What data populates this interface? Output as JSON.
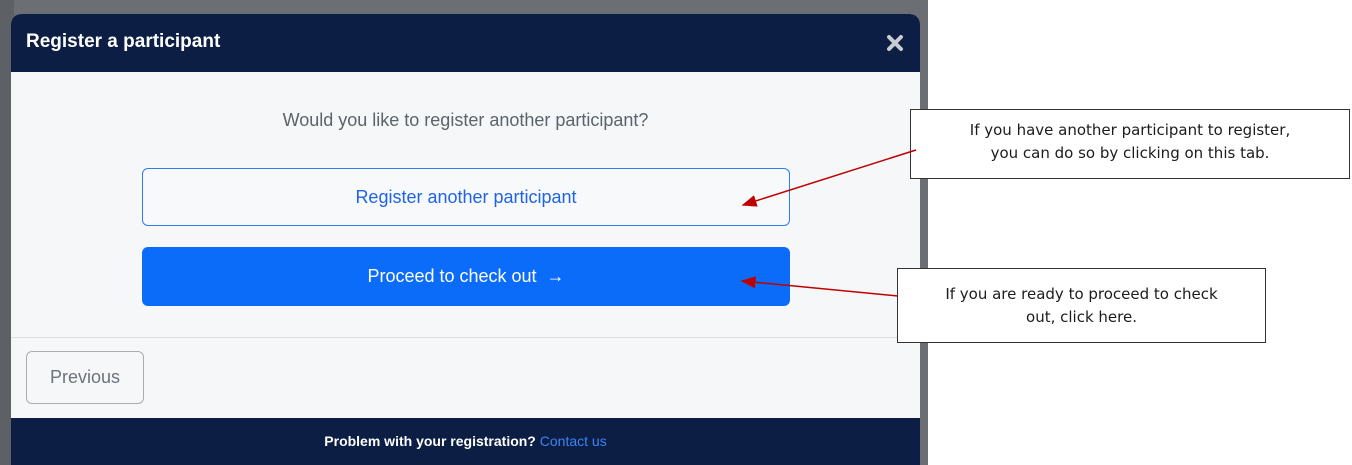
{
  "modal": {
    "title": "Register a participant",
    "question": "Would you like to register another participant?",
    "register_another_label": "Register another participant",
    "proceed_label": "Proceed to check out",
    "proceed_arrow": "→",
    "previous_label": "Previous",
    "footer_text": "Problem with your registration?",
    "footer_link": "Contact us"
  },
  "annotations": {
    "callout_1_line_1": "If you have another participant to register,",
    "callout_1_line_2": "you can do so by clicking on this tab.",
    "callout_2_line_1": "If you are ready to proceed to check",
    "callout_2_line_2": "out, click here."
  },
  "colors": {
    "header_bg": "#0c1e44",
    "primary": "#0a6cf9",
    "arrow": "#c00000"
  },
  "icons": [
    "close-icon",
    "arrow-right-icon"
  ]
}
